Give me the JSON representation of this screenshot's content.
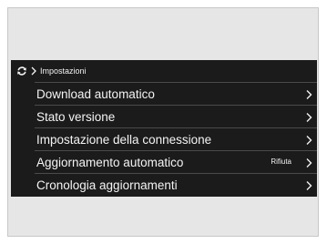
{
  "breadcrumb": {
    "icon": "refresh-icon",
    "separator_icon": "chevron-right-icon",
    "label": "Impostazioni"
  },
  "menu": {
    "items": [
      {
        "label": "Download automatico",
        "value": "",
        "icon": "chevron-right-icon"
      },
      {
        "label": "Stato versione",
        "value": "",
        "icon": "chevron-right-icon"
      },
      {
        "label": "Impostazione della connessione",
        "value": "",
        "icon": "chevron-right-icon"
      },
      {
        "label": "Aggiornamento automatico",
        "value": "Rifiuta",
        "icon": "chevron-right-icon"
      },
      {
        "label": "Cronologia aggiornamenti",
        "value": "",
        "icon": "chevron-right-icon"
      }
    ]
  },
  "colors": {
    "screen_background": "#1b1b1b",
    "frame_background": "#e6e6e6",
    "text": "#f4f4f4",
    "divider": "#4a4a4a"
  }
}
